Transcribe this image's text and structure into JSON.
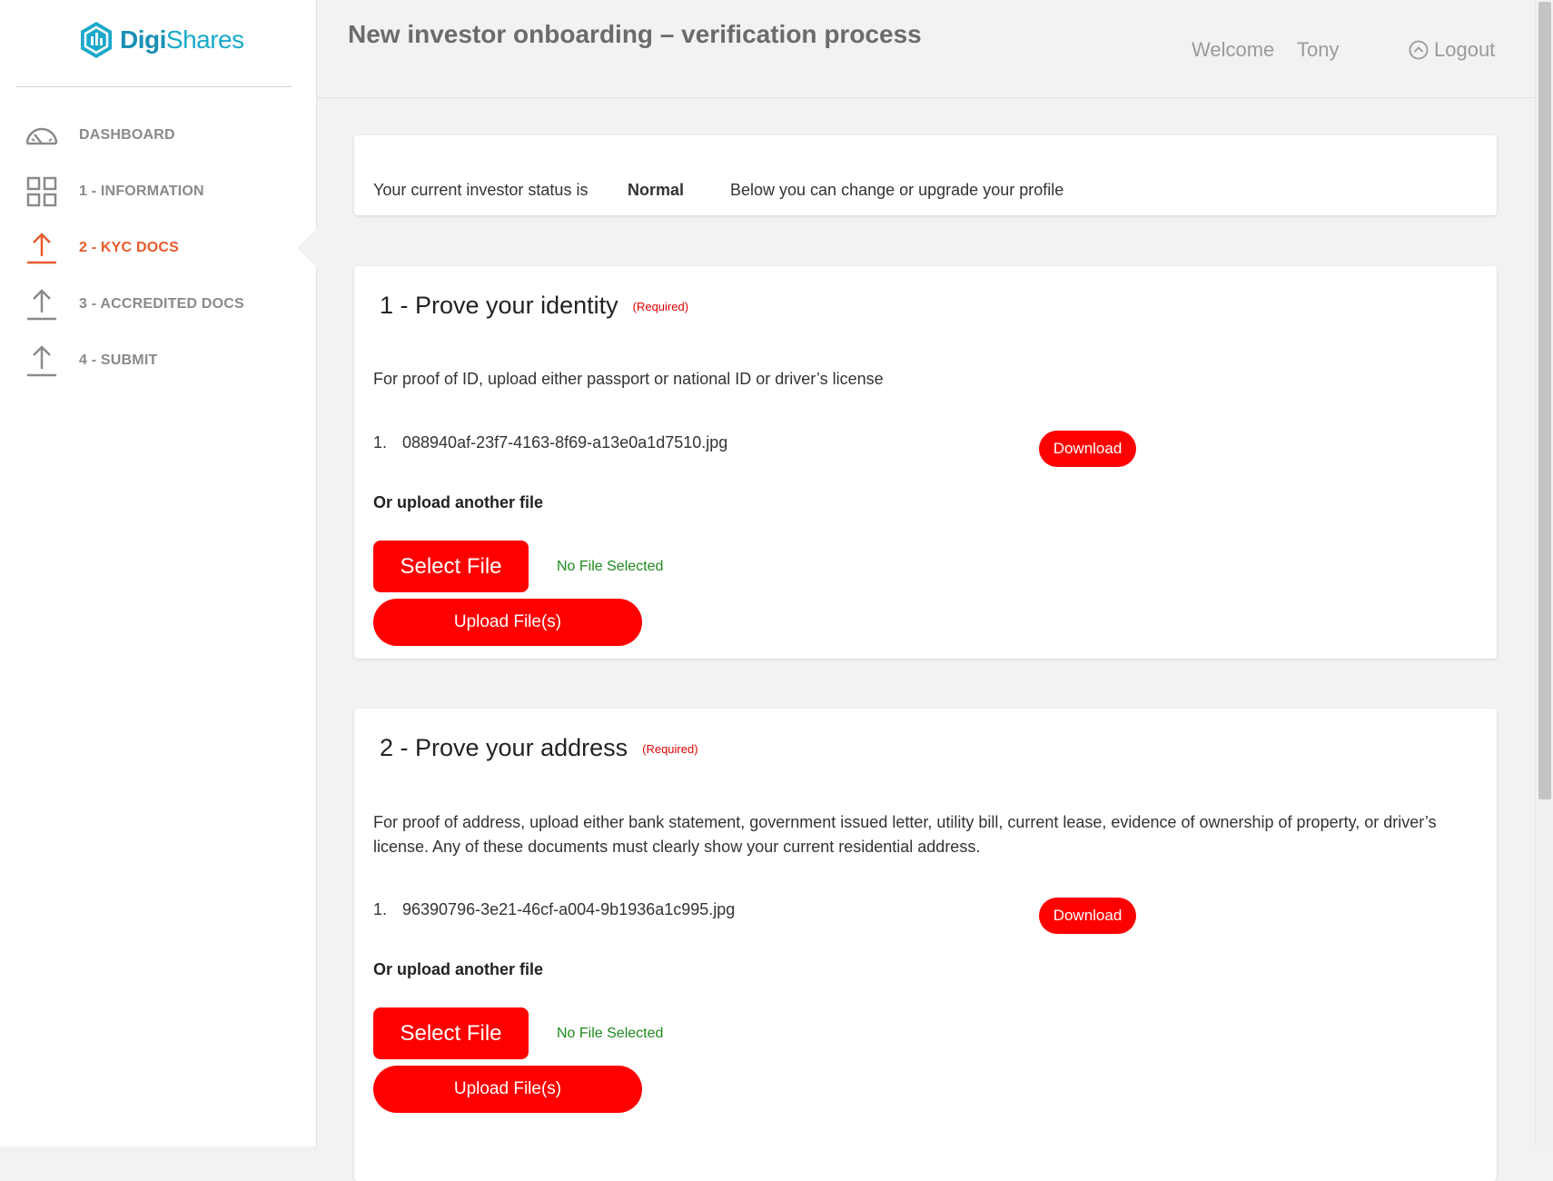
{
  "brand": {
    "name_prefix": "Digi",
    "name_suffix": "Shares"
  },
  "header": {
    "title": "New investor onboarding – verification process",
    "welcome": "Welcome",
    "username": "Tony",
    "logout": "Logout"
  },
  "sidebar": {
    "items": [
      {
        "label": "DASHBOARD",
        "icon": "dashboard-gauge-icon"
      },
      {
        "label": "1 - INFORMATION",
        "icon": "grid-icon"
      },
      {
        "label": "2 - KYC DOCS",
        "icon": "upload-arrow-icon",
        "active": true
      },
      {
        "label": "3 - ACCREDITED DOCS",
        "icon": "upload-arrow-icon"
      },
      {
        "label": "4 - SUBMIT",
        "icon": "upload-arrow-icon"
      }
    ]
  },
  "status": {
    "label": "Your current investor status is",
    "value": "Normal",
    "note": "Below you can change or upgrade your profile"
  },
  "sections": [
    {
      "title": "1 - Prove your identity",
      "required": "(Required)",
      "description": "For proof of ID, upload either passport or national ID or driver’s license",
      "file_number": "1.",
      "file_name": "088940af-23f7-4163-8f69-a13e0a1d7510.jpg",
      "download_label": "Download",
      "upload_label": "Or upload another file",
      "select_label": "Select File",
      "no_file_label": "No File Selected",
      "upload_button": "Upload File(s)"
    },
    {
      "title": "2 - Prove your address",
      "required": "(Required)",
      "description": "For proof of address, upload either bank statement, government issued letter, utility bill, current lease, evidence of ownership of property, or driver’s license. Any of these documents must clearly show your current residential address.",
      "file_number": "1.",
      "file_name": "96390796-3e21-46cf-a004-9b1936a1c995.jpg",
      "download_label": "Download",
      "upload_label": "Or upload another file",
      "select_label": "Select File",
      "no_file_label": "No File Selected",
      "upload_button": "Upload File(s)"
    }
  ],
  "colors": {
    "accent": "#ff0000",
    "active_nav": "#e85a2c",
    "brand": "#1aa9c9",
    "success_text": "#1f8a1f"
  }
}
